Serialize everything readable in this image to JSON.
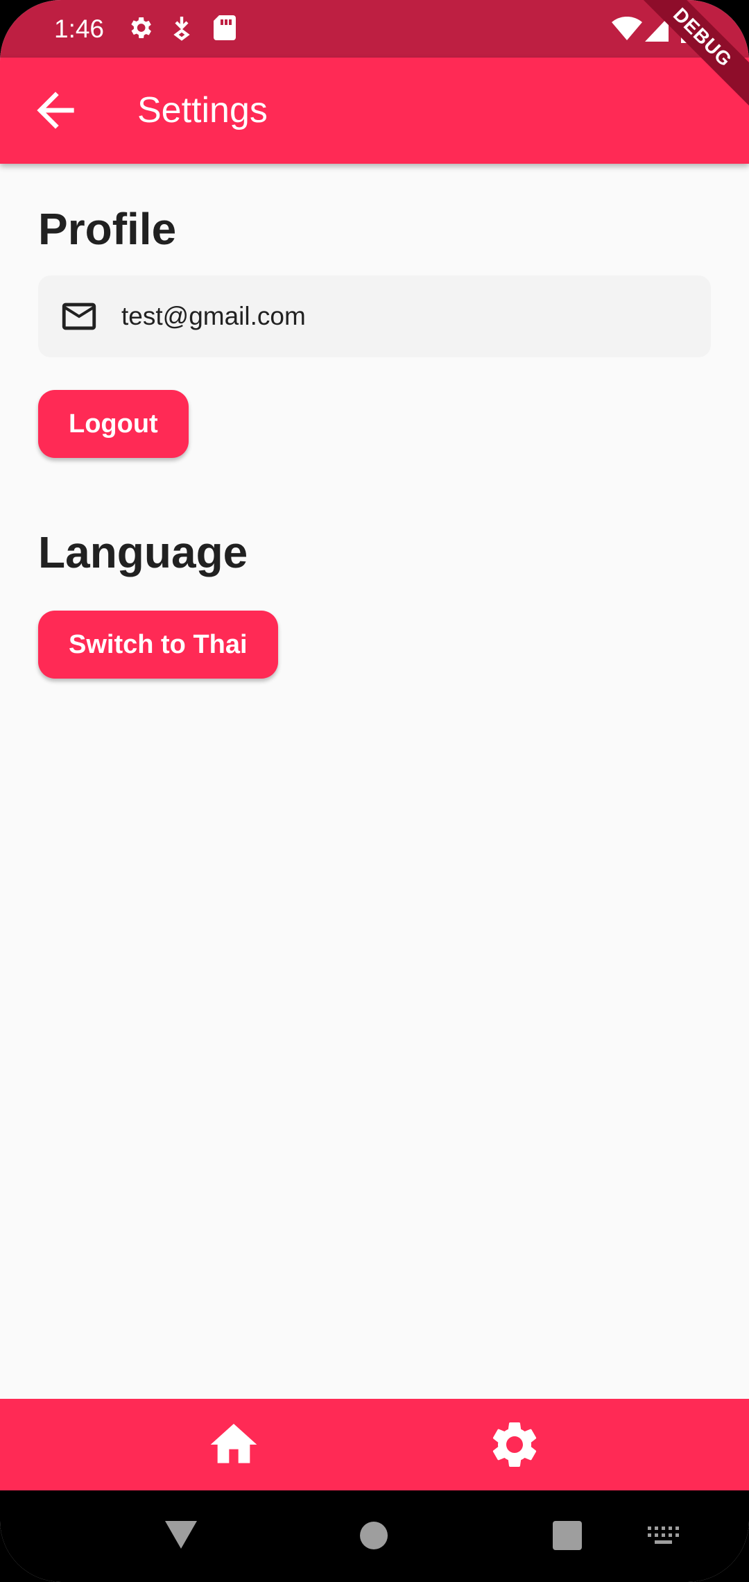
{
  "status_bar": {
    "time": "1:46",
    "icons_left": [
      "gear-icon",
      "download-icon",
      "sd-card-icon"
    ],
    "icons_right": [
      "wifi-icon",
      "cell-signal-icon",
      "battery-icon"
    ]
  },
  "app_bar": {
    "title": "Settings",
    "back_icon": "arrow-back-icon"
  },
  "debug_banner": "DEBUG",
  "profile": {
    "heading": "Profile",
    "email_icon": "mail-icon",
    "email": "test@gmail.com",
    "logout_label": "Logout"
  },
  "language": {
    "heading": "Language",
    "switch_label": "Switch to Thai"
  },
  "bottom_nav": {
    "items": [
      {
        "icon": "home-icon"
      },
      {
        "icon": "settings-icon"
      }
    ]
  },
  "system_nav": [
    "back-triangle-icon",
    "home-circle-icon",
    "recents-square-icon",
    "keyboard-icon"
  ],
  "colors": {
    "accent": "#FF2A55",
    "status_bar": "#BE1F42",
    "background": "#FAFAFA",
    "card": "#F3F3F3"
  }
}
